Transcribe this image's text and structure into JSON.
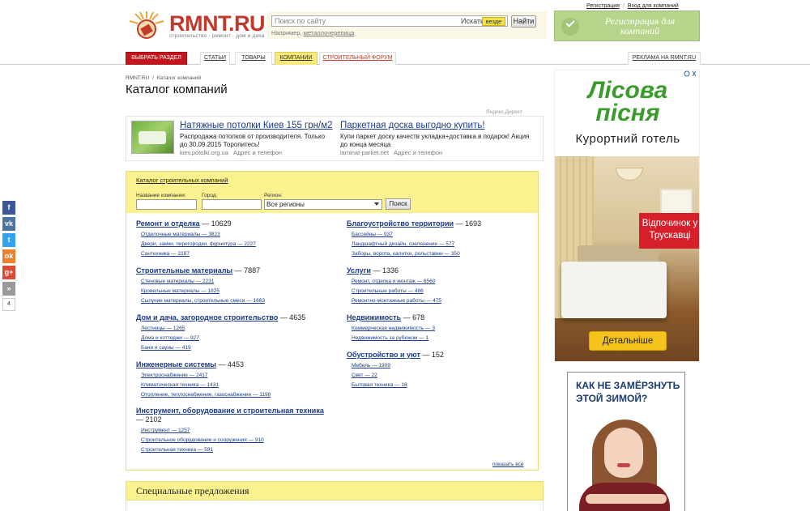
{
  "header": {
    "logo_text": "RMNT.RU",
    "logo_sub": "строительство · ремонт · дом и дача",
    "search_placeholder": "Поиск по сайту",
    "search_where": "Искать",
    "search_scope": "везде",
    "search_button": "Найти",
    "search_example_prefix": "Например,",
    "search_example_link": "металлочерепица",
    "register_link": "Регистрация",
    "login_link": "Вход для компаний",
    "reg_banner": "Регистрация для компаний"
  },
  "nav": {
    "choose_section": "ВЫБРАТЬ РАЗДЕЛ",
    "articles": "СТАТЬИ",
    "goods": "ТОВАРЫ",
    "companies": "КОМПАНИИ",
    "forum": "СТРОИТЕЛЬНЫЙ ФОРУМ",
    "advertising": "РЕКЛАМА НА RMNT.RU"
  },
  "breadcrumb": {
    "home": "RMNT.RU",
    "separator": "/",
    "current": "Каталог компаний"
  },
  "page_title": "Каталог компаний",
  "ads": {
    "label": "Яндекс.Директ",
    "ad1": {
      "title": "Натяжные потолки Киев 155 грн/м2",
      "text": "Распродажа потолков от производителя. Только до 30.09.2015 Торопитесь!",
      "url": "kiev.potolki.org.ua",
      "sub": "Адрес и телефон"
    },
    "ad2": {
      "title": "Паркетная доска выгодно купить!",
      "text": "Купи паркет доску качеств укладка+доставка в подарок! Акция до конца месяца",
      "url": "laminat-parket.net",
      "sub": "Адрес и телефон"
    }
  },
  "catalog": {
    "link": "Каталог строительных компаний",
    "label_company": "Название компании:",
    "label_city": "Город:",
    "label_region": "Регион:",
    "region_value": "Все регионы",
    "search_button": "Поиск",
    "show_all": "показать все",
    "left": [
      {
        "title": "Ремонт и отделка",
        "count": "— 10629",
        "subs": [
          "Отделочные материалы — 3823",
          "Двери, замки, перегородки, фурнитура — 2227",
          "Сантехника — 2187"
        ]
      },
      {
        "title": "Строительные материалы",
        "count": "— 7887",
        "subs": [
          "Стеновые материалы — 2231",
          "Кровельные материалы — 1825",
          "Сыпучие материалы, строительные смеси — 1663"
        ]
      },
      {
        "title": "Дом и дача, загородное строительство",
        "count": "— 4635",
        "subs": [
          "Лестницы — 1265",
          "Дома и коттеджи — 927",
          "Бани и сауны — 419"
        ]
      },
      {
        "title": "Инженерные системы",
        "count": "— 4453",
        "subs": [
          "Электроснабжение — 2417",
          "Климатическая техника — 1431",
          "Отопление, теплоснабжение, газоснабжение — 1198"
        ]
      },
      {
        "title": "Инструмент, оборудование и строительная техника",
        "count": "— 2102",
        "subs": [
          "Инструмент — 1257",
          "Строительное оборудование и сооружения — 910",
          "Строительная техника — 591"
        ]
      }
    ],
    "right": [
      {
        "title": "Благоустройство территории",
        "count": "— 1693",
        "subs": [
          "Бассейны — 937",
          "Ландшафтный дизайн, озеленение — 577",
          "Заборы, ворота, калитки, рольставни — 350"
        ]
      },
      {
        "title": "Услуги",
        "count": "— 1336",
        "subs": [
          "Ремонт, отделка и монтаж — 6560",
          "Строительные работы — 486",
          "Ремонтно-монтажные работы — 475"
        ]
      },
      {
        "title": "Недвижимость",
        "count": "— 678",
        "subs": [
          "Коммерческая недвижимость — 3",
          "Недвижимость за рубежом — 1"
        ]
      },
      {
        "title": "Обустройство и уют",
        "count": "— 152",
        "subs": [
          "Мебель — 1909",
          "Свет — 22",
          "Бытовая техника — 18"
        ]
      }
    ]
  },
  "special_offers": "Специальные предложения",
  "social": {
    "count": "4",
    "buttons": [
      {
        "icon": "facebook-icon",
        "glyph": "f",
        "color": "#3b5998"
      },
      {
        "icon": "vkontakte-icon",
        "glyph": "vk",
        "color": "#4c75a3"
      },
      {
        "icon": "twitter-icon",
        "glyph": "t",
        "color": "#2ea3f2"
      },
      {
        "icon": "odnoklassniki-icon",
        "glyph": "ok",
        "color": "#ed812b"
      },
      {
        "icon": "google-plus-icon",
        "glyph": "g+",
        "color": "#dc4a38"
      },
      {
        "icon": "share-more-icon",
        "glyph": "»",
        "color": "#999999"
      }
    ]
  },
  "banner1": {
    "brand_line1": "Лісова",
    "brand_line2": "пісня",
    "subtitle": "Курортний готель",
    "badge": "Відпочинок у Трускавці",
    "button": "Детальніше"
  },
  "banner2": {
    "text": "КАК НЕ ЗАМЁРЗНУТЬ ЭТОЙ ЗИМОЙ?"
  }
}
